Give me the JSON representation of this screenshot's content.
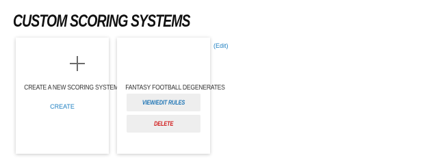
{
  "page": {
    "title": "CUSTOM SCORING SYSTEMS"
  },
  "new_card": {
    "label": "CREATE A NEW SCORING SYSTEM",
    "create_label": "CREATE"
  },
  "system_card": {
    "name": "FANTASY FOOTBALL DEGENERATES",
    "view_edit_label": "VIEW/EDIT RULES",
    "delete_label": "DELETE"
  },
  "edit_link": "(Edit)",
  "colors": {
    "link": "#1e7fc1",
    "view_button_text": "#1f75b5",
    "delete_button_text": "#d11b1b",
    "button_bg": "#eeeeee"
  },
  "icons": {
    "add": "plus-icon"
  }
}
